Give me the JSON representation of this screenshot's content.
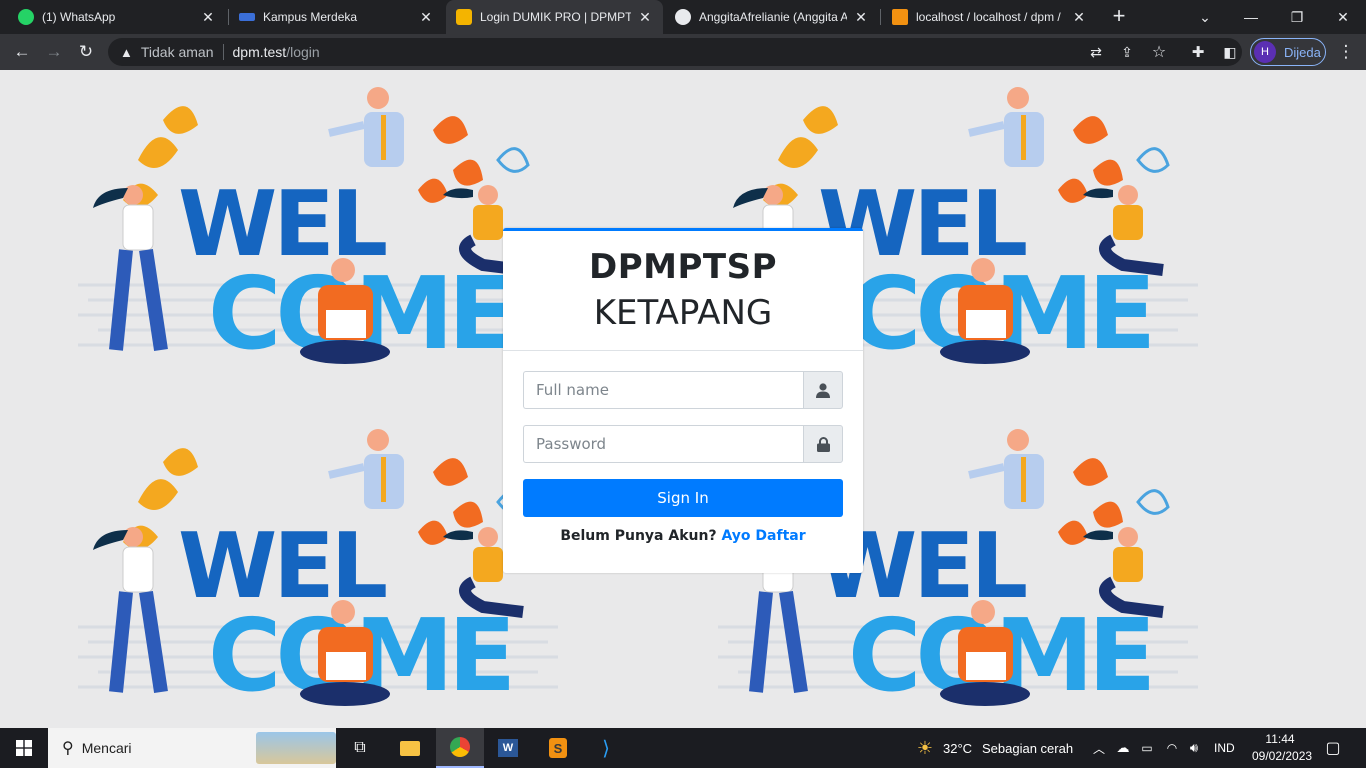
{
  "browser": {
    "tabs": [
      {
        "title": "(1) WhatsApp",
        "icon": "whatsapp-icon"
      },
      {
        "title": "Kampus Merdeka",
        "icon": "kampus-merdeka-icon"
      },
      {
        "title": "Login DUMIK PRO | DPMPTSP",
        "icon": "dumik-icon",
        "active": true
      },
      {
        "title": "AnggitaAfrelianie (Anggita A",
        "icon": "github-icon"
      },
      {
        "title": "localhost / localhost / dpm /",
        "icon": "phpmyadmin-icon"
      }
    ],
    "address": {
      "security_label": "Tidak aman",
      "host": "dpm.test",
      "path": "/login"
    },
    "profile": {
      "initial": "H",
      "label": "Dijeda"
    }
  },
  "login": {
    "brand_line1": "DPMPTSP",
    "brand_line2": "KETAPANG",
    "fullname_placeholder": "Full name",
    "password_placeholder": "Password",
    "signin_label": "Sign In",
    "register_prompt": "Belum Punya Akun?",
    "register_link": "Ayo Daftar",
    "accent_color": "#007bff"
  },
  "taskbar": {
    "search_placeholder": "Mencari",
    "weather_temp": "32°C",
    "weather_text": "Sebagian cerah",
    "language": "IND",
    "time": "11:44",
    "date": "09/02/2023"
  }
}
